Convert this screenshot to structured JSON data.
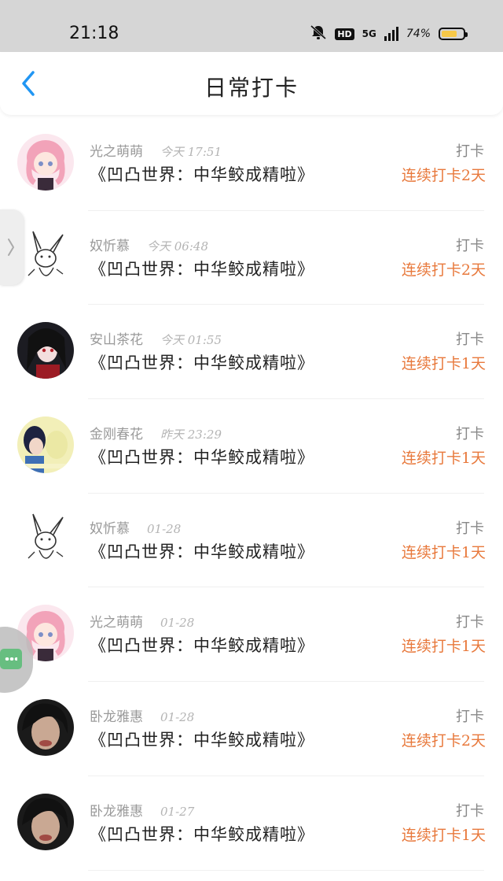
{
  "status_bar": {
    "time": "21:18",
    "hd": "HD",
    "network": "5G",
    "battery": "74%",
    "battery_level": 0.74,
    "icons": [
      "mute-bell-icon",
      "hd-icon",
      "signal-5g-icon",
      "battery-icon"
    ]
  },
  "header": {
    "back_icon": "chevron-left-icon",
    "title": "日常打卡",
    "accent": "#2196f3"
  },
  "colors": {
    "streak": "#e8793c",
    "name": "#9a9a9a",
    "book": "#222222"
  },
  "entries": [
    {
      "user": "光之萌萌",
      "time": "今天 17:51",
      "book": "《凹凸世界：中华鲛成精啦》",
      "action": "打卡",
      "streak": "连续打卡2天",
      "avatar": "anime-girl-pink-hair"
    },
    {
      "user": "奴忻慕",
      "time": "今天 06:48",
      "book": "《凹凸世界：中华鲛成精啦》",
      "action": "打卡",
      "streak": "连续打卡2天",
      "avatar": "rabbit-sketch"
    },
    {
      "user": "安山茶花",
      "time": "今天 01:55",
      "book": "《凹凸世界：中华鲛成精啦》",
      "action": "打卡",
      "streak": "连续打卡1天",
      "avatar": "anime-girl-black-hair"
    },
    {
      "user": "金刚春花",
      "time": "昨天 23:29",
      "book": "《凹凸世界：中华鲛成精啦》",
      "action": "打卡",
      "streak": "连续打卡1天",
      "avatar": "couple-yellow"
    },
    {
      "user": "奴忻慕",
      "time": "01-28",
      "book": "《凹凸世界：中华鲛成精啦》",
      "action": "打卡",
      "streak": "连续打卡1天",
      "avatar": "rabbit-sketch"
    },
    {
      "user": "光之萌萌",
      "time": "01-28",
      "book": "《凹凸世界：中华鲛成精啦》",
      "action": "打卡",
      "streak": "连续打卡1天",
      "avatar": "anime-girl-pink-hair"
    },
    {
      "user": "卧龙雅惠",
      "time": "01-28",
      "book": "《凹凸世界：中华鲛成精啦》",
      "action": "打卡",
      "streak": "连续打卡2天",
      "avatar": "dark-photo"
    },
    {
      "user": "卧龙雅惠",
      "time": "01-27",
      "book": "《凹凸世界：中华鲛成精啦》",
      "action": "打卡",
      "streak": "连续打卡1天",
      "avatar": "dark-photo"
    }
  ],
  "side_tab": {
    "icon": "chevron-right-icon"
  },
  "floating_button": {
    "icon": "chat-bubble-icon",
    "color": "#4db36a"
  }
}
